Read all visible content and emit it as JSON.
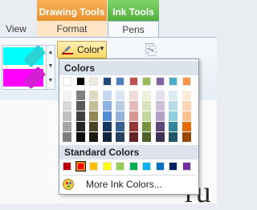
{
  "ribbon": {
    "context_tabs": {
      "drawing_tools": "Drawing Tools",
      "ink_tools": "Ink Tools"
    },
    "tabs": {
      "view": "View",
      "format": "Format",
      "pens": "Pens"
    },
    "color_button": {
      "label": "Color",
      "current_color": "#c00000"
    },
    "pen_swatches": [
      "#00ffff",
      "#ff00ff"
    ]
  },
  "color_menu": {
    "theme_header": "Colors",
    "theme_row": [
      "#ffffff",
      "#000000",
      "#eeece1",
      "#1f497d",
      "#4f81bd",
      "#c0504d",
      "#9bbb59",
      "#8064a2",
      "#4bacc6",
      "#f79646"
    ],
    "theme_shades": [
      [
        "#f2f2f2",
        "#7f7f7f",
        "#ddd9c3",
        "#c6d9f0",
        "#dbe5f1",
        "#f2dcdb",
        "#ebf1dd",
        "#e5e0ec",
        "#dbeef3",
        "#fdeada"
      ],
      [
        "#d8d8d8",
        "#595959",
        "#c4bd97",
        "#8db3e2",
        "#b8cce4",
        "#e5b9b7",
        "#d7e3bc",
        "#ccc1d9",
        "#b7dde8",
        "#fbd5b5"
      ],
      [
        "#bfbfbf",
        "#3f3f3f",
        "#938953",
        "#548dd4",
        "#95b3d7",
        "#d99694",
        "#c3d69b",
        "#b2a2c7",
        "#92cddc",
        "#fac08f"
      ],
      [
        "#a5a5a5",
        "#262626",
        "#494429",
        "#17365d",
        "#366092",
        "#953734",
        "#76923c",
        "#5f497a",
        "#31859b",
        "#e36c09"
      ],
      [
        "#7f7f7f",
        "#0c0c0c",
        "#1d1b10",
        "#0f243e",
        "#244061",
        "#632423",
        "#4f6128",
        "#3f3151",
        "#205867",
        "#974806"
      ]
    ],
    "standard_header": "Standard Colors",
    "standard_row": [
      "#c00000",
      "#ff0000",
      "#ffc000",
      "#ffff00",
      "#92d050",
      "#00b050",
      "#00b0f0",
      "#0070c0",
      "#002060",
      "#7030a0"
    ],
    "selected_standard_index": 1,
    "more_label": "More Ink Colors..."
  },
  "document": {
    "visible_text": "ru"
  }
}
